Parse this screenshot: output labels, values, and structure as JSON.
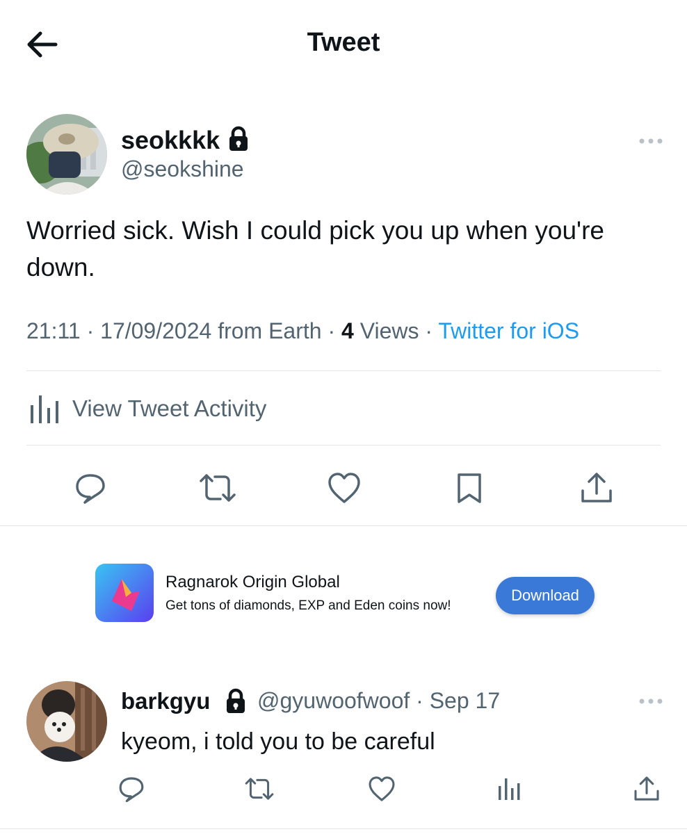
{
  "header": {
    "title": "Tweet",
    "back_icon": "arrow-left-icon"
  },
  "tweet": {
    "author_name": "seokkkk",
    "author_handle": "@seokshine",
    "protected_icon": "lock-icon",
    "text": "Worried sick. Wish I could pick you up when you're down.",
    "time": "21:11",
    "date": "17/09/2024",
    "location": "from Earth",
    "views_count": "4",
    "views_label": "Views",
    "client": "Twitter for iOS",
    "activity_label": "View Tweet Activity",
    "actions": [
      "reply-icon",
      "retweet-icon",
      "like-icon",
      "bookmark-icon",
      "share-icon"
    ]
  },
  "ad": {
    "title": "Ragnarok Origin Global",
    "subtitle": "Get tons of diamonds, EXP and Eden coins now!",
    "button": "Download"
  },
  "reply": {
    "author_name": "barkgyu",
    "author_handle": "@gyuwoofwoof",
    "date": "Sep 17",
    "text": "kyeom, i told you to be careful",
    "actions": [
      "reply-icon",
      "retweet-icon",
      "like-icon",
      "analytics-icon",
      "share-icon"
    ]
  },
  "colors": {
    "accent": "#1d9bf0",
    "muted": "#536471",
    "text": "#0f1419",
    "ad_button": "#3b79d8"
  }
}
